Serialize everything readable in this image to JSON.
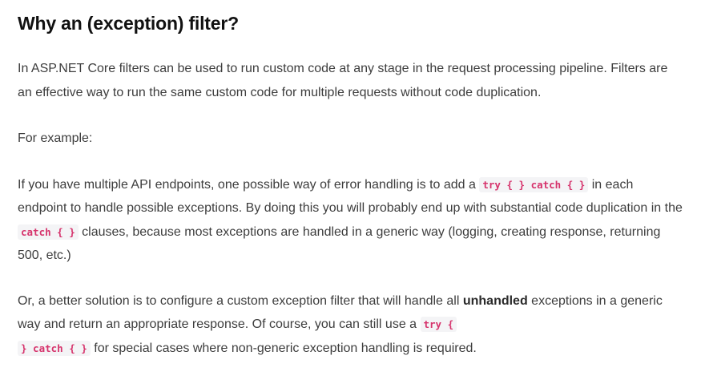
{
  "heading": "Why an (exception) filter?",
  "p1": "In ASP.NET Core filters can be used to run custom code at any stage in the request processing pipeline. Filters are an effective way to run the same custom code for multiple requests without code duplication.",
  "p2": "For example:",
  "p3": {
    "t1": "If you have multiple API endpoints, one possible way of error handling is to add a ",
    "c1": "try { } catch { }",
    "t2": " in each endpoint to handle possible exceptions. By doing this you will probably end up with substantial code duplication in the ",
    "c2": "catch { }",
    "t3": " clauses, because most exceptions are handled in a generic way (logging, creating response, returning 500, etc.)"
  },
  "p4": {
    "t1": "Or, a better solution is to configure a custom exception filter that will handle all ",
    "bold": "unhandled",
    "t2": " exceptions in a generic way and return an appropriate response. Of course, you can still use a ",
    "c1a": "try {",
    "c1b": "} catch { }",
    "t3": " for special cases where non-generic exception handling is required."
  }
}
